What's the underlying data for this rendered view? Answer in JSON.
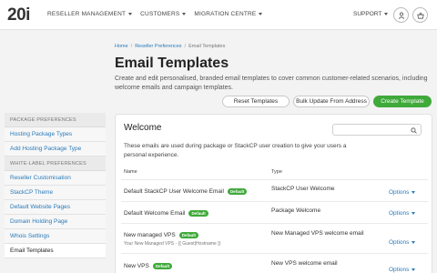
{
  "header": {
    "logo": "20i",
    "nav": [
      "RESELLER MANAGEMENT",
      "CUSTOMERS",
      "MIGRATION CENTRE"
    ],
    "support": "SUPPORT"
  },
  "breadcrumb": [
    "Home",
    "Reseller Preferences",
    "Email Templates"
  ],
  "page": {
    "title": "Email Templates",
    "intro": "Create and edit personalised, branded email templates to cover common customer-related scenarios, including welcome emails and campaign templates."
  },
  "actions": {
    "reset": "Reset Templates",
    "bulk": "Bulk Update From Address",
    "create": "Create Template"
  },
  "sidebar": {
    "group1": "PACKAGE PREFERENCES",
    "group1_items": [
      "Hosting Package Types",
      "Add Hosting Package Type"
    ],
    "group2": "WHITE-LABEL PREFERENCES",
    "group2_items": [
      "Reseller Customisation",
      "StackCP Theme",
      "Default Website Pages",
      "Domain Holding Page",
      "Whois Settings",
      "Email Templates"
    ]
  },
  "panel": {
    "title": "Welcome",
    "description": "These emails are used during package or StackCP user creation to give your users a personal experience.",
    "col_name": "Name",
    "col_type": "Type",
    "rows": [
      {
        "name": "Default StackCP User Welcome Email",
        "badge": "Default",
        "sub": "",
        "type": "StackCP User Welcome",
        "options": "Options"
      },
      {
        "name": "Default Welcome Email",
        "badge": "Default",
        "sub": "",
        "type": "Package Welcome",
        "options": "Options"
      },
      {
        "name": "New managed VPS",
        "badge": "Default",
        "sub": "Your New Managed VPS - {{ Guest|Hostname }}",
        "type": "New Managed VPS welcome email",
        "options": "Options"
      },
      {
        "name": "New VPS",
        "badge": "Default",
        "sub": "",
        "type": "New VPS welcome email",
        "options": "Options"
      }
    ]
  },
  "colors": {
    "accent": "#3fa93a",
    "link": "#2a7ab8"
  }
}
